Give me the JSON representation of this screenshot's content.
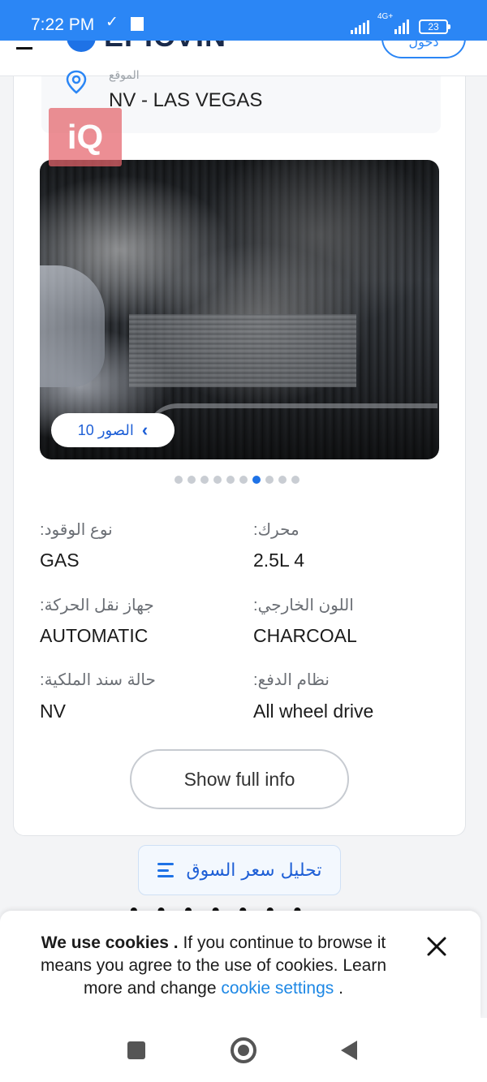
{
  "status_bar": {
    "time": "7:22 PM",
    "network": "4G+",
    "battery": "23"
  },
  "header": {
    "logo_text": "EPICVIN",
    "login_label": "دخول"
  },
  "location": {
    "label": "الموقع",
    "value": "NV - LAS VEGAS"
  },
  "watermark": "iQ",
  "photos": {
    "button_label": "الصور 10",
    "dot_count": 10,
    "active_dot": 6
  },
  "specs": {
    "engine": {
      "label": ":محرك",
      "value": "2.5L 4"
    },
    "fuel": {
      "label": ":نوع الوقود",
      "value": "GAS"
    },
    "exterior_color": {
      "label": ":اللون الخارجي",
      "value": "CHARCOAL"
    },
    "transmission": {
      "label": ":جهاز نقل الحركة",
      "value": "AUTOMATIC"
    },
    "drive": {
      "label": ":نظام الدفع",
      "value": "All wheel drive"
    },
    "title_status": {
      "label": ":حالة سند الملكية",
      "value": "NV"
    }
  },
  "show_full_info": "Show full info",
  "market_analysis": "تحليل سعر السوق",
  "cookie": {
    "bold": "We use cookies .",
    "text": " If you continue to browse it means you agree to the use of cookies. Learn more and change ",
    "link": "cookie settings",
    "end": " ."
  },
  "colors": {
    "accent": "#2b86f5",
    "link": "#1e88e5",
    "status_bar": "#2b86f5"
  }
}
